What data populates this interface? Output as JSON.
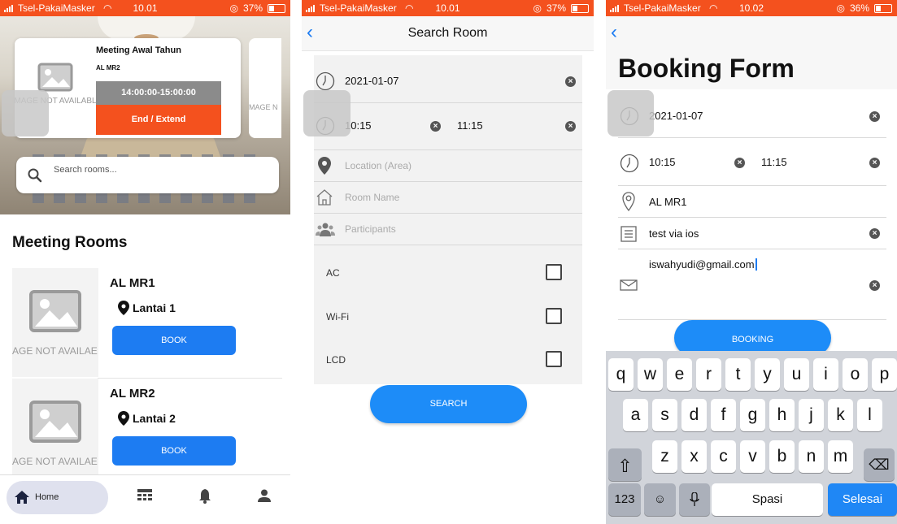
{
  "colors": {
    "accent": "#1d7cf2",
    "orange": "#f4511e",
    "grey_time": "#8b8b8b"
  },
  "screens": [
    {
      "status": {
        "carrier": "Tsel-PakaiMasker",
        "time": "10.01",
        "battery": "37%"
      },
      "event_card": {
        "title": "Meeting Awal Tahun",
        "room": "AL MR2",
        "time": "14:00:00-15:00:00",
        "action": "End / Extend",
        "image_placeholder": "MAGE NOT AVAILABL",
        "next_placeholder": "MAGE N"
      },
      "search_placeholder": "Search rooms...",
      "section_title": "Meeting Rooms",
      "rooms": [
        {
          "name": "AL MR1",
          "location": "Lantai 1",
          "button": "BOOK",
          "image_placeholder": "AGE NOT AVAILAE"
        },
        {
          "name": "AL MR2",
          "location": "Lantai 2",
          "button": "BOOK",
          "image_placeholder": "AGE NOT AVAILAE"
        }
      ],
      "nav": {
        "home_label": "Home",
        "icons": [
          "home-icon",
          "table-icon",
          "bell-icon",
          "person-icon"
        ]
      }
    },
    {
      "status": {
        "carrier": "Tsel-PakaiMasker",
        "time": "10.01",
        "battery": "37%"
      },
      "title": "Search Room",
      "date": "2021-01-07",
      "time_start": "10:15",
      "time_end": "11:15",
      "placeholders": {
        "location": "Location (Area)",
        "room_name": "Room Name",
        "participants": "Participants"
      },
      "facilities": [
        {
          "label": "AC",
          "checked": false
        },
        {
          "label": "Wi-Fi",
          "checked": false
        },
        {
          "label": "LCD",
          "checked": false
        }
      ],
      "search_button": "SEARCH"
    },
    {
      "status": {
        "carrier": "Tsel-PakaiMasker",
        "time": "10.02",
        "battery": "36%"
      },
      "title": "Booking Form",
      "date": "2021-01-07",
      "time_start": "10:15",
      "time_end": "11:15",
      "room": "AL MR1",
      "agenda": "test via ios",
      "email": "iswahyudi@gmail.com",
      "booking_button": "BOOKING",
      "keyboard": {
        "row1": [
          "q",
          "w",
          "e",
          "r",
          "t",
          "y",
          "u",
          "i",
          "o",
          "p"
        ],
        "row2": [
          "a",
          "s",
          "d",
          "f",
          "g",
          "h",
          "j",
          "k",
          "l"
        ],
        "row3": [
          "z",
          "x",
          "c",
          "v",
          "b",
          "n",
          "m"
        ],
        "numbers": "123",
        "space": "Spasi",
        "done": "Selesai"
      }
    }
  ]
}
